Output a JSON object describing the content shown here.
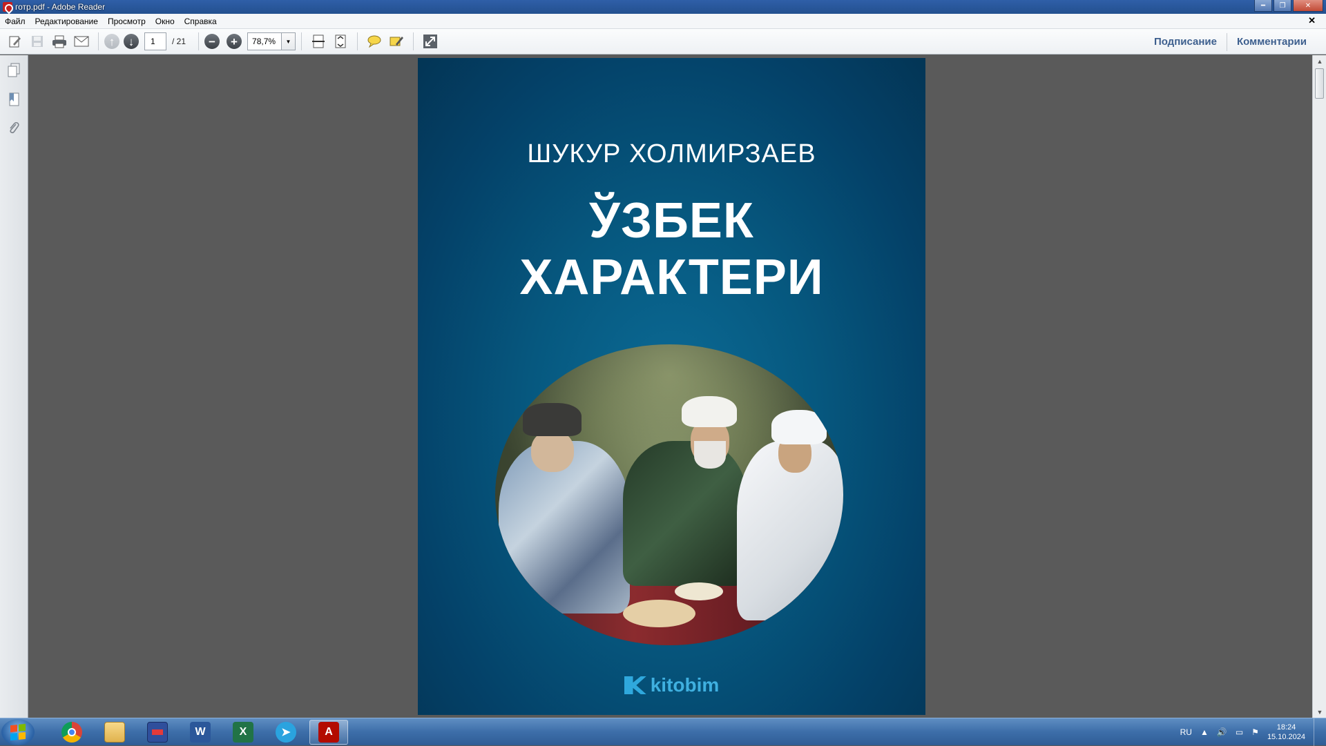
{
  "window": {
    "title": "готр.pdf - Adobe Reader"
  },
  "menu": {
    "items": [
      "Файл",
      "Редактирование",
      "Просмотр",
      "Окно",
      "Справка"
    ]
  },
  "toolbar": {
    "current_page": "1",
    "total_pages": "/ 21",
    "zoom": "78,7%",
    "sign_label": "Подписание",
    "comments_label": "Комментарии"
  },
  "document": {
    "author": "ШУКУР ХОЛМИРЗАЕВ",
    "title_line1": "ЎЗБЕК",
    "title_line2": "ХАРАКТЕРИ",
    "publisher": "kitobim",
    "cover_colors": {
      "background": "#065a82",
      "logo": "#2fa8dd"
    }
  },
  "taskbar": {
    "apps": [
      "chrome",
      "explorer",
      "save",
      "word",
      "excel",
      "telegram",
      "acrobat-reader"
    ],
    "language": "RU",
    "time": "18:24",
    "date": "15.10.2024"
  }
}
